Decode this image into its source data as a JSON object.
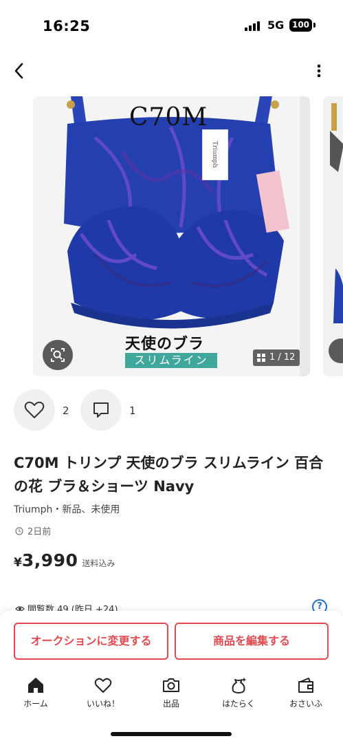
{
  "status_bar": {
    "time": "16:25",
    "network": "5G",
    "battery": "100"
  },
  "photo": {
    "size_text": "C70M",
    "tag_text": "Triumph",
    "caption_1": "天使のブラ",
    "caption_2": "スリムライン",
    "counter": "1 / 12"
  },
  "social": {
    "likes": "2",
    "comments": "1"
  },
  "product": {
    "title": "C70M トリンプ 天使のブラ スリムライン 百合の花 ブラ＆ショーツ Navy",
    "meta": "Triumph・新品、未使用",
    "time": "2日前",
    "price_symbol": "¥",
    "price": "3,990",
    "shipping": "送料込み",
    "views": "閲覧数 49 (昨日 +24)"
  },
  "buttons": {
    "auction": "オークションに変更する",
    "edit": "商品を編集する",
    "help": "?"
  },
  "tabs": [
    {
      "label": "ホーム",
      "icon": "home-icon"
    },
    {
      "label": "いいね！",
      "icon": "heart-icon"
    },
    {
      "label": "出品",
      "icon": "camera-icon"
    },
    {
      "label": "はたらく",
      "icon": "work-bag-icon"
    },
    {
      "label": "おさいふ",
      "icon": "wallet-icon"
    }
  ],
  "colors": {
    "accent": "#e5484d",
    "help": "#1a6fd6",
    "bra": "#2440b0",
    "lace": "#7a4fd8",
    "caption_bg": "#3fa89a"
  }
}
